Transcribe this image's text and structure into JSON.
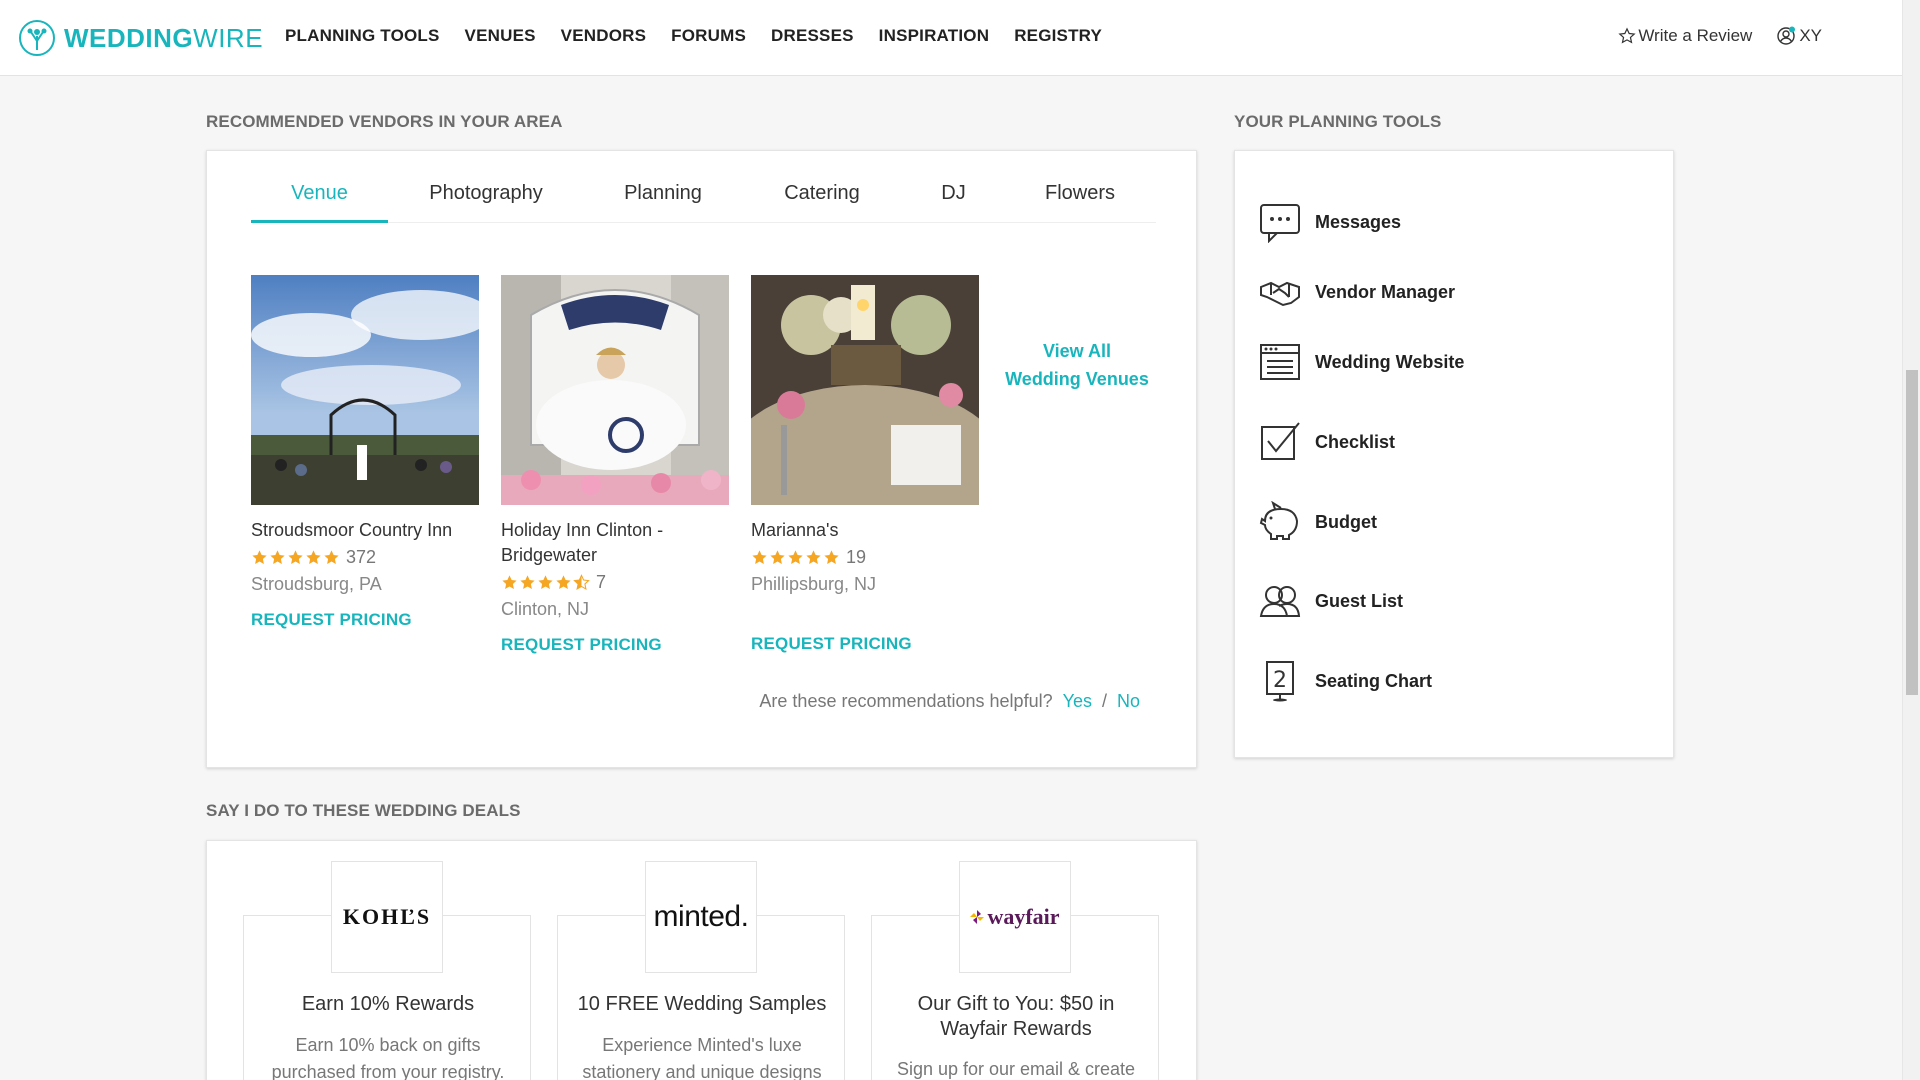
{
  "header": {
    "brand": "WEDDINGWIRE",
    "brand_strong": "WEDDING",
    "brand_light": "WIRE",
    "nav": [
      "PLANNING TOOLS",
      "VENUES",
      "VENDORS",
      "FORUMS",
      "DRESSES",
      "INSPIRATION",
      "REGISTRY"
    ],
    "write_review": "Write a Review",
    "user": "XY"
  },
  "recommended": {
    "title": "RECOMMENDED VENDORS IN YOUR AREA",
    "tabs": [
      "Venue",
      "Photography",
      "Planning",
      "Catering",
      "DJ",
      "Flowers"
    ],
    "active_tab": "Venue",
    "vendors": [
      {
        "name": "Stroudsmoor Country Inn",
        "rating": 5,
        "count": "372",
        "location": "Stroudsburg, PA",
        "cta": "REQUEST PRICING"
      },
      {
        "name": "Holiday Inn Clinton - Bridgewater",
        "rating": 4.5,
        "count": "7",
        "location": "Clinton, NJ",
        "cta": "REQUEST PRICING"
      },
      {
        "name": "Marianna's",
        "rating": 5,
        "count": "19",
        "location": "Phillipsburg, NJ",
        "cta": "REQUEST PRICING"
      }
    ],
    "view_all_line1": "View All",
    "view_all_line2": "Wedding Venues",
    "helpful_question": "Are these recommendations helpful?",
    "yes": "Yes",
    "separator": "/",
    "no": "No"
  },
  "tools": {
    "title": "YOUR PLANNING TOOLS",
    "items": [
      {
        "label": "Messages",
        "icon": "messages-icon"
      },
      {
        "label": "Vendor Manager",
        "icon": "handshake-icon"
      },
      {
        "label": "Wedding Website",
        "icon": "browser-window-icon"
      },
      {
        "label": "Checklist",
        "icon": "checklist-icon"
      },
      {
        "label": "Budget",
        "icon": "piggy-bank-icon"
      },
      {
        "label": "Guest List",
        "icon": "guests-icon"
      },
      {
        "label": "Seating Chart",
        "icon": "table-number-icon"
      }
    ]
  },
  "deals": {
    "title": "SAY I DO TO THESE WEDDING DEALS",
    "items": [
      {
        "brand": "KOHĽS",
        "title": "Earn 10% Rewards",
        "desc1": "Earn 10% back on gifts",
        "desc2": "purchased from your registry."
      },
      {
        "brand": "minted.",
        "title": "10 FREE Wedding Samples",
        "desc1": "Experience Minted's luxe",
        "desc2": "stationery and unique designs"
      },
      {
        "brand": "wayfair",
        "title_line1": "Our Gift to You: $50 in",
        "title_line2": "Wayfair Rewards",
        "desc1": "Sign up for our email & create"
      }
    ]
  },
  "colors": {
    "accent": "#19b5bc",
    "star": "#f5a623"
  }
}
